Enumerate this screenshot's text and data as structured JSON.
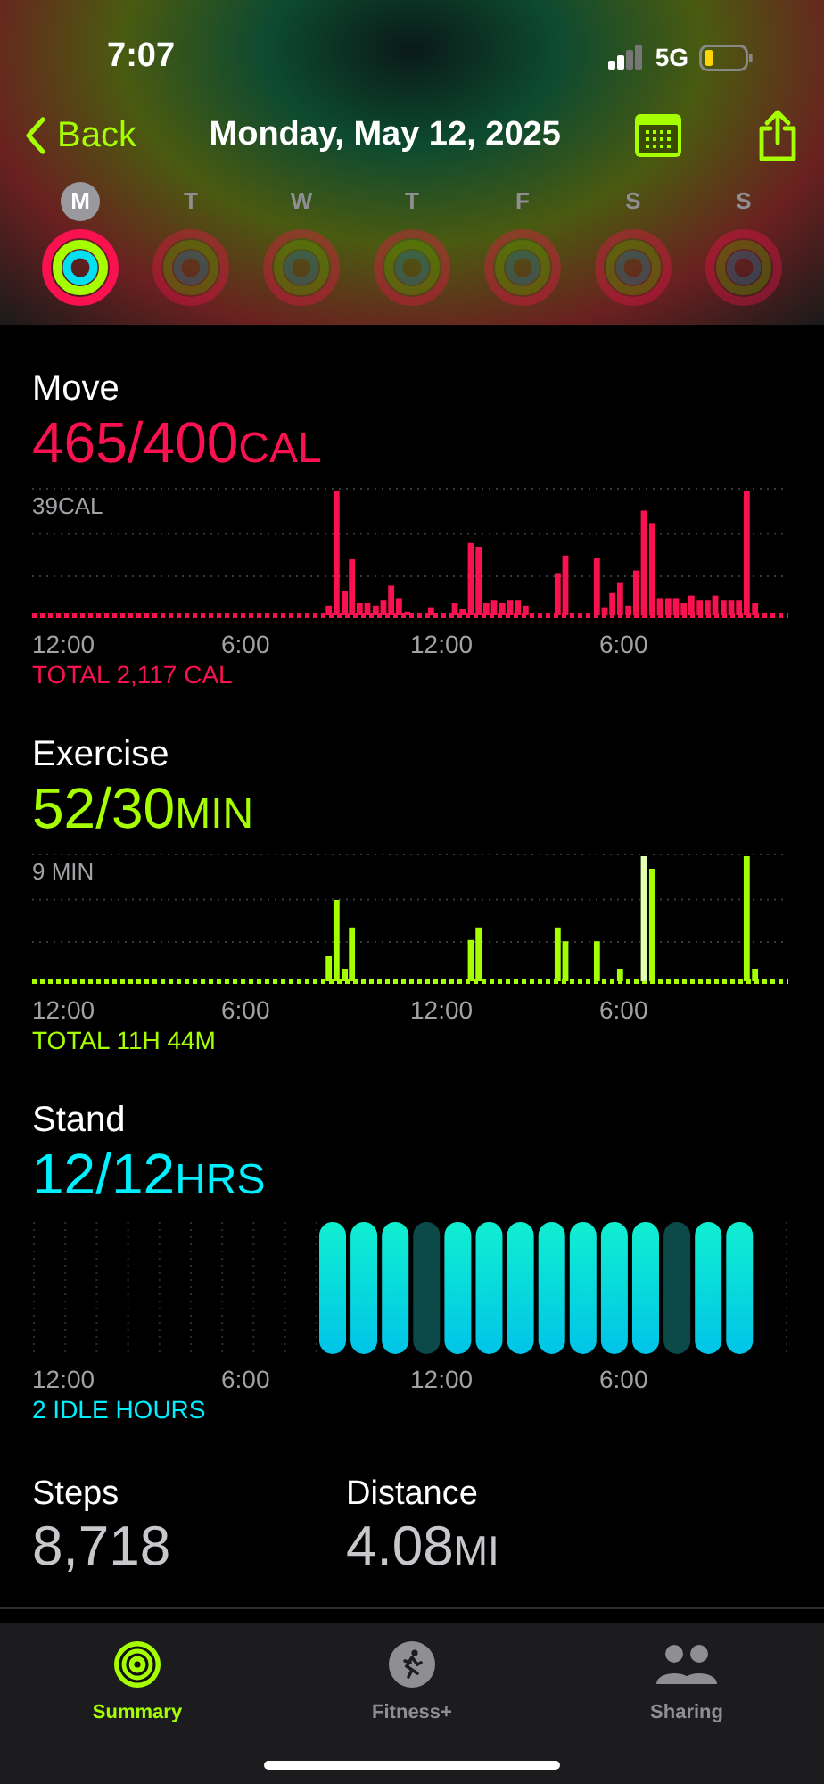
{
  "status_bar": {
    "time": "7:07",
    "network": "5G"
  },
  "nav": {
    "back": "Back",
    "title": "Monday, May 12, 2025"
  },
  "week": [
    {
      "label": "M",
      "selected": true
    },
    {
      "label": "T",
      "selected": false
    },
    {
      "label": "W",
      "selected": false
    },
    {
      "label": "T",
      "selected": false
    },
    {
      "label": "F",
      "selected": false
    },
    {
      "label": "S",
      "selected": false
    },
    {
      "label": "S",
      "selected": false
    }
  ],
  "sections": [
    {
      "kind": "move",
      "title": "Move",
      "value": "465/400",
      "unit": "CAL",
      "top_label": "39CAL",
      "axis": [
        "12:00",
        "6:00",
        "12:00",
        "6:00"
      ],
      "total": "TOTAL 2,117 CAL"
    },
    {
      "kind": "exercise",
      "title": "Exercise",
      "value": "52/30",
      "unit": "MIN",
      "top_label": "9 MIN",
      "axis": [
        "12:00",
        "6:00",
        "12:00",
        "6:00"
      ],
      "total": "TOTAL 11H 44M"
    },
    {
      "kind": "stand",
      "title": "Stand",
      "value": "12/12",
      "unit": "HRS",
      "axis": [
        "12:00",
        "6:00",
        "12:00",
        "6:00"
      ],
      "total": "2 IDLE HOURS"
    }
  ],
  "stats": [
    {
      "label": "Steps",
      "value": "8,718"
    },
    {
      "label": "Distance",
      "value": "4.08",
      "unit": "MI"
    }
  ],
  "tab_bar": [
    {
      "kind": "summary",
      "label": "Summary",
      "selected": true
    },
    {
      "kind": "fitness",
      "label": "Fitness+",
      "selected": false
    },
    {
      "kind": "sharing",
      "label": "Sharing",
      "selected": false
    }
  ]
}
